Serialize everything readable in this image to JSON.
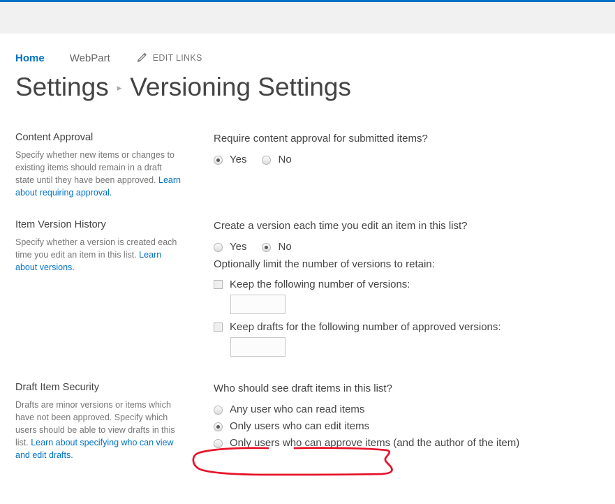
{
  "theme": {
    "brand_bar_color": "#0072c6",
    "suite_bar_color": "#f1f1f1",
    "link_color": "#0072c6",
    "text_color": "#444444",
    "muted_text_color": "#767676",
    "annotation_color": "#e8132b"
  },
  "topnav": {
    "home_label": "Home",
    "webpart_label": "WebPart",
    "edit_links_label": "EDIT LINKS",
    "pencil_icon": "pencil-icon"
  },
  "breadcrumb": {
    "parent": "Settings",
    "separator": "▸",
    "current": "Versioning Settings"
  },
  "sections": {
    "content_approval": {
      "title": "Content Approval",
      "desc_text": "Specify whether new items or changes to existing items should remain in a draft state until they have been approved.",
      "desc_link": "Learn about requiring approval.",
      "question": "Require content approval for submitted items?",
      "options": [
        {
          "label": "Yes",
          "checked": true
        },
        {
          "label": "No",
          "checked": false
        }
      ]
    },
    "item_version_history": {
      "title": "Item Version History",
      "desc_text": "Specify whether a version is created each time you edit an item in this list.",
      "desc_link": "Learn about versions.",
      "question": "Create a version each time you edit an item in this list?",
      "options": [
        {
          "label": "Yes",
          "checked": false
        },
        {
          "label": "No",
          "checked": true
        }
      ],
      "limit_question": "Optionally limit the number of versions to retain:",
      "keep_versions_label": "Keep the following number of versions:",
      "keep_versions_checked": false,
      "keep_versions_value": "",
      "keep_drafts_label": "Keep drafts for the following number of approved versions:",
      "keep_drafts_checked": false,
      "keep_drafts_value": ""
    },
    "draft_item_security": {
      "title": "Draft Item Security",
      "desc_text": "Drafts are minor versions or items which have not been approved. Specify which users should be able to view drafts in this list.",
      "desc_link": "Learn about specifying who can view and edit drafts.",
      "question": "Who should see draft items in this list?",
      "options": [
        {
          "label": "Any user who can read items",
          "checked": false
        },
        {
          "label": "Only users who can edit items",
          "checked": true
        },
        {
          "label": "Only users who can approve items (and the author of the item)",
          "checked": false
        }
      ]
    }
  },
  "annotation": {
    "shape": "hand-drawn-red-ellipse",
    "targets": "Only users who can edit items"
  }
}
